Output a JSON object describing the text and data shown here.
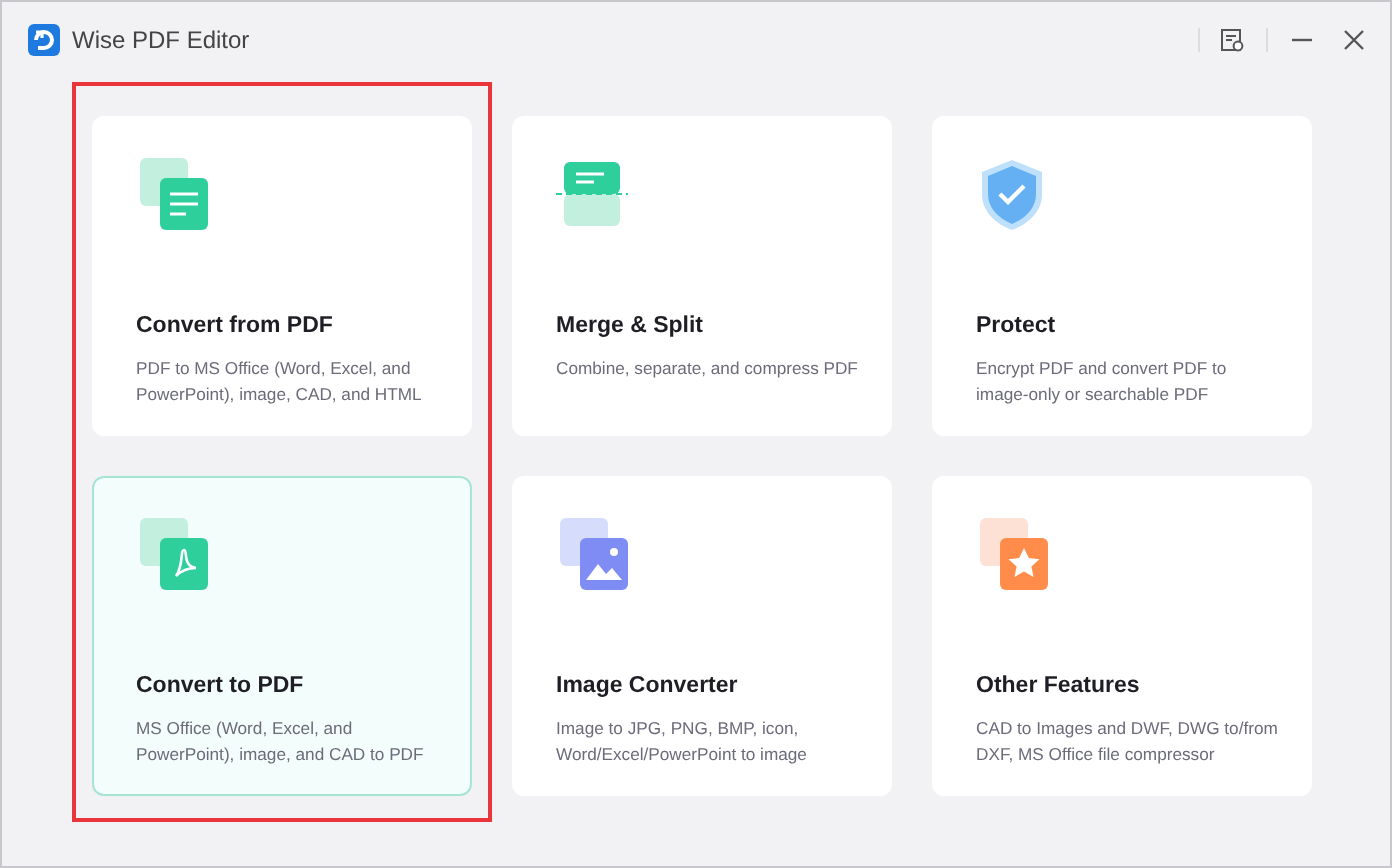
{
  "window": {
    "title": "Wise PDF Editor"
  },
  "columns": [
    {
      "highlighted": true,
      "cards": [
        {
          "title": "Convert from PDF",
          "description": "PDF to MS Office (Word, Excel, and PowerPoint), image, CAD, and HTML",
          "kind": "document",
          "selected": false
        },
        {
          "title": "Convert to PDF",
          "description": "MS Office (Word, Excel, and PowerPoint), image, and CAD to PDF",
          "kind": "pdf",
          "selected": true
        }
      ]
    },
    {
      "highlighted": false,
      "cards": [
        {
          "title": "Merge & Split",
          "description": "Combine, separate, and compress PDF",
          "kind": "split",
          "selected": false
        },
        {
          "title": "Image Converter",
          "description": "Image to JPG, PNG, BMP, icon, Word/Excel/PowerPoint to image",
          "kind": "image",
          "selected": false
        }
      ]
    },
    {
      "highlighted": false,
      "cards": [
        {
          "title": "Protect",
          "description": "Encrypt PDF and convert PDF to image-only or searchable PDF",
          "kind": "shield",
          "selected": false
        },
        {
          "title": "Other Features",
          "description": "CAD to Images and DWF, DWG to/from DXF, MS Office file compressor",
          "kind": "star",
          "selected": false
        }
      ]
    }
  ]
}
